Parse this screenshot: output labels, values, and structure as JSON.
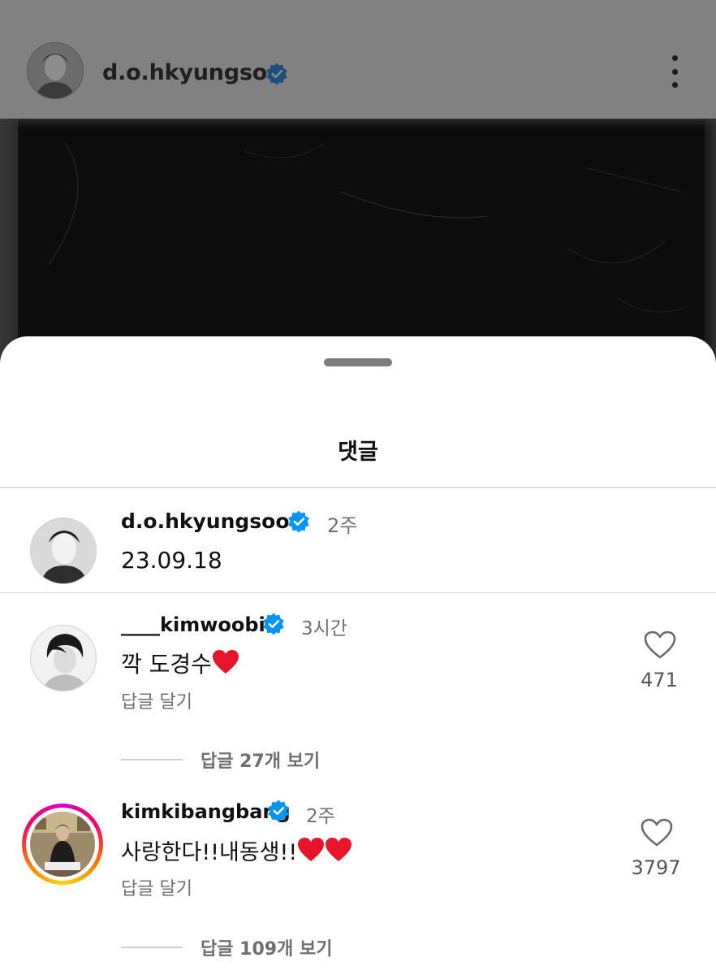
{
  "post": {
    "username": "d.o.hkyungsoo"
  },
  "sheet": {
    "title": "댓글"
  },
  "caption": {
    "username": "d.o.hkyungsoo",
    "time": "2주",
    "text": "23.09.18"
  },
  "comments": [
    {
      "username": "____kimwoobin",
      "time": "3시간",
      "text": "깍 도경수",
      "reply_label": "답글 달기",
      "likes": "471",
      "view_replies": "답글 27개 보기"
    },
    {
      "username": "kimkibangbang",
      "time": "2주",
      "text": "사랑한다!!내동생!!",
      "reply_label": "답글 달기",
      "likes": "3797",
      "view_replies": "답글 109개 보기"
    }
  ],
  "colors": {
    "verified_blue": "#0095f6",
    "heart_red": "#e8152a",
    "dim_overlay": "#818181"
  },
  "icons": [
    "verified-icon",
    "more-options-icon",
    "heart-icon",
    "red-heart-emoji"
  ]
}
